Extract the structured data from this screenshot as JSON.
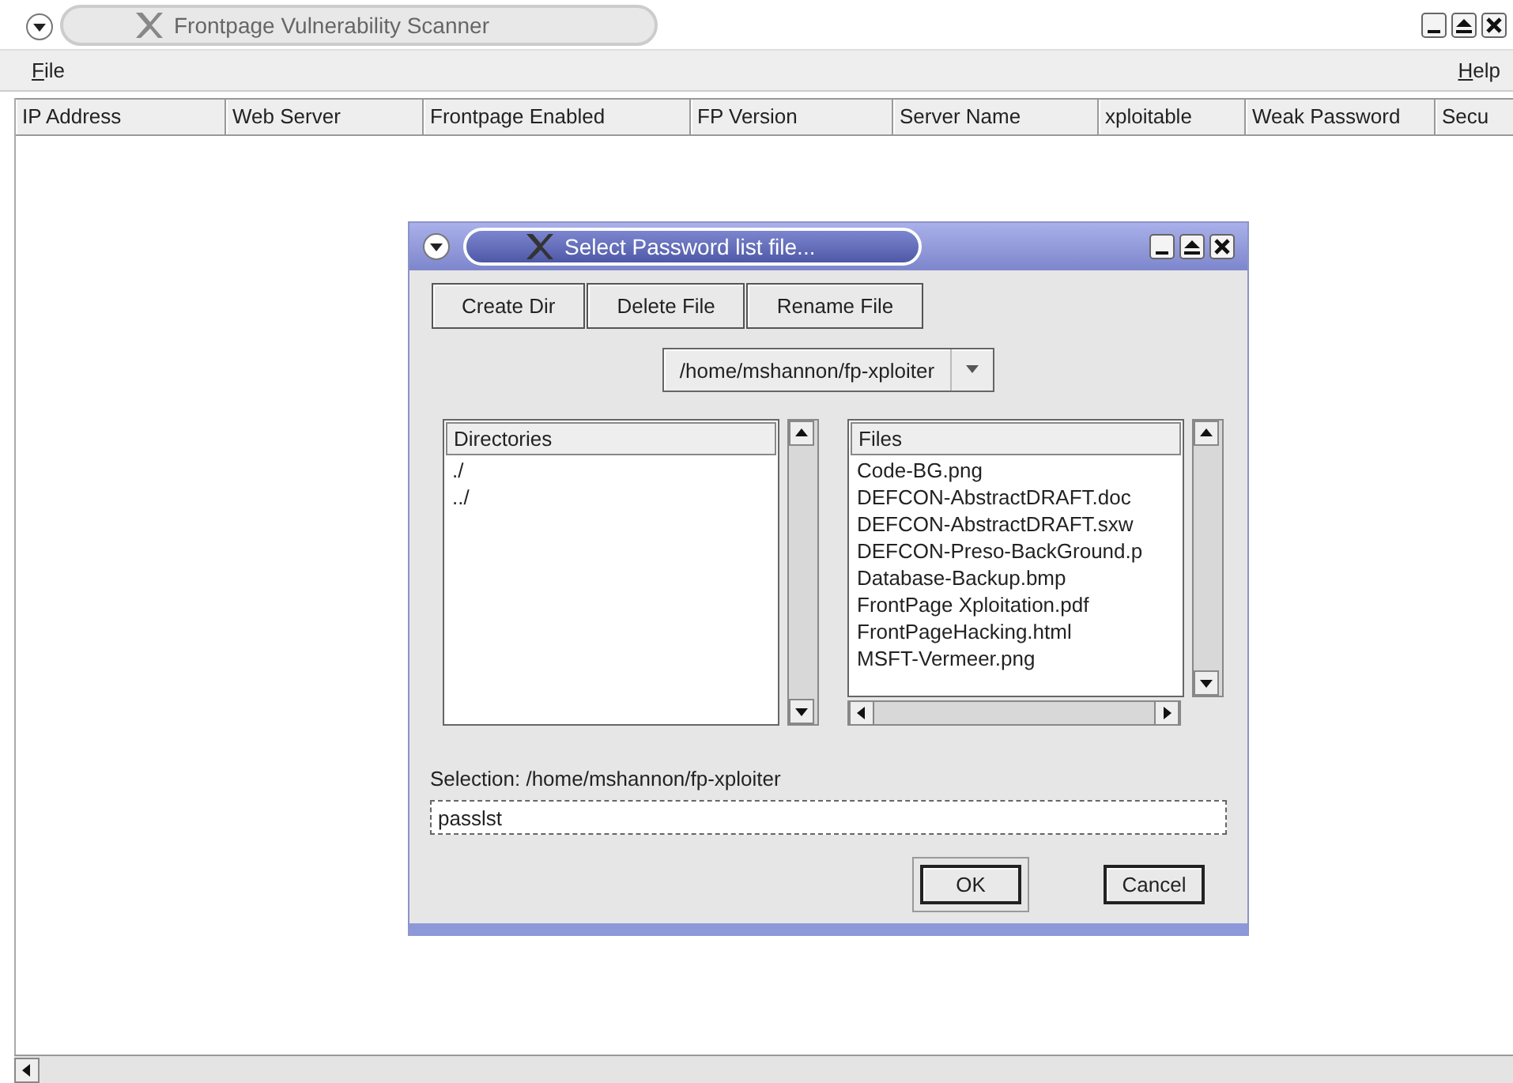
{
  "window": {
    "title": "Frontpage Vulnerability Scanner"
  },
  "menu": [
    {
      "label": "File"
    },
    {
      "label": "Help"
    }
  ],
  "table": {
    "columns": [
      "IP Address",
      "Web Server",
      "Frontpage Enabled",
      "FP Version",
      "Server Name",
      "xploitable",
      "Weak Password",
      "Secu"
    ]
  },
  "dialog": {
    "title": "Select Password list file...",
    "buttons": [
      "Create Dir",
      "Delete File",
      "Rename File"
    ],
    "path": "/home/mshannon/fp-xploiter",
    "directories": {
      "heading": "Directories",
      "items": [
        "./",
        "../"
      ]
    },
    "files": {
      "heading": "Files",
      "items": [
        "Code-BG.png",
        "DEFCON-AbstractDRAFT.doc",
        "DEFCON-AbstractDRAFT.sxw",
        "DEFCON-Preso-BackGround.p",
        "Database-Backup.bmp",
        "FrontPage Xploitation.pdf",
        "FrontPageHacking.html",
        "MSFT-Vermeer.png"
      ]
    },
    "selection_label": "Selection: /home/mshannon/fp-xploiter",
    "filename": "passlst",
    "ok": "OK",
    "cancel": "Cancel"
  }
}
